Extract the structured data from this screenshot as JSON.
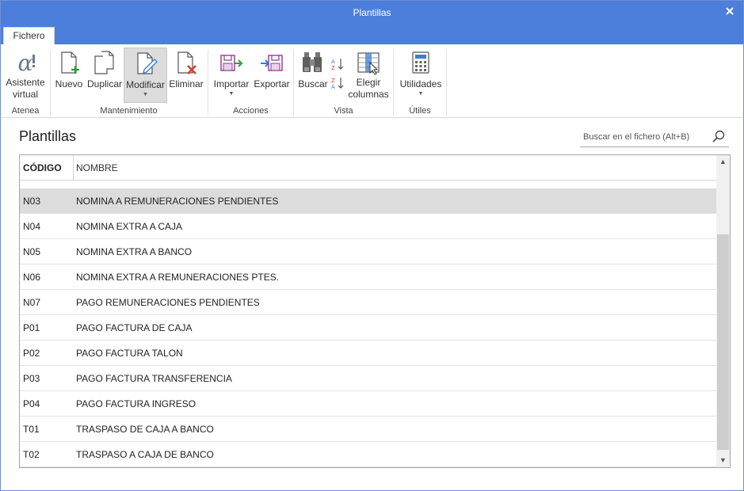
{
  "window": {
    "title": "Plantillas"
  },
  "tabs": [
    {
      "label": "Fichero"
    }
  ],
  "ribbon": {
    "groups": {
      "atenea": "Atenea",
      "mantenimiento": "Mantenimiento",
      "acciones": "Acciones",
      "vista": "Vista",
      "utiles": "Útiles"
    },
    "buttons": {
      "asistente": "Asistente\nvirtual",
      "nuevo": "Nuevo",
      "duplicar": "Duplicar",
      "modificar": "Modificar",
      "eliminar": "Eliminar",
      "importar": "Importar",
      "exportar": "Exportar",
      "buscar": "Buscar",
      "elegir": "Elegir\ncolumnas",
      "utilidades": "Utilidades"
    }
  },
  "page": {
    "title": "Plantillas"
  },
  "search": {
    "placeholder": "Buscar en el fichero (Alt+B)"
  },
  "table": {
    "columns": {
      "code": "CÓDIGO",
      "name": "NOMBRE"
    },
    "rows": [
      {
        "code": "N03",
        "name": "NOMINA A REMUNERACIONES PENDIENTES",
        "selected": true
      },
      {
        "code": "N04",
        "name": "NOMINA EXTRA A CAJA"
      },
      {
        "code": "N05",
        "name": "NOMINA EXTRA A BANCO"
      },
      {
        "code": "N06",
        "name": "NOMINA EXTRA A REMUNERACIONES PTES."
      },
      {
        "code": "N07",
        "name": "PAGO REMUNERACIONES PENDIENTES"
      },
      {
        "code": "P01",
        "name": "PAGO FACTURA DE CAJA"
      },
      {
        "code": "P02",
        "name": "PAGO FACTURA TALON"
      },
      {
        "code": "P03",
        "name": "PAGO FACTURA TRANSFERENCIA"
      },
      {
        "code": "P04",
        "name": "PAGO FACTURA INGRESO"
      },
      {
        "code": "T01",
        "name": "TRASPASO DE CAJA A BANCO"
      },
      {
        "code": "T02",
        "name": "TRASPASO A CAJA DE BANCO"
      }
    ]
  },
  "colors": {
    "titlebar": "#4b7fdb",
    "selected_row": "#dcdcdc"
  }
}
